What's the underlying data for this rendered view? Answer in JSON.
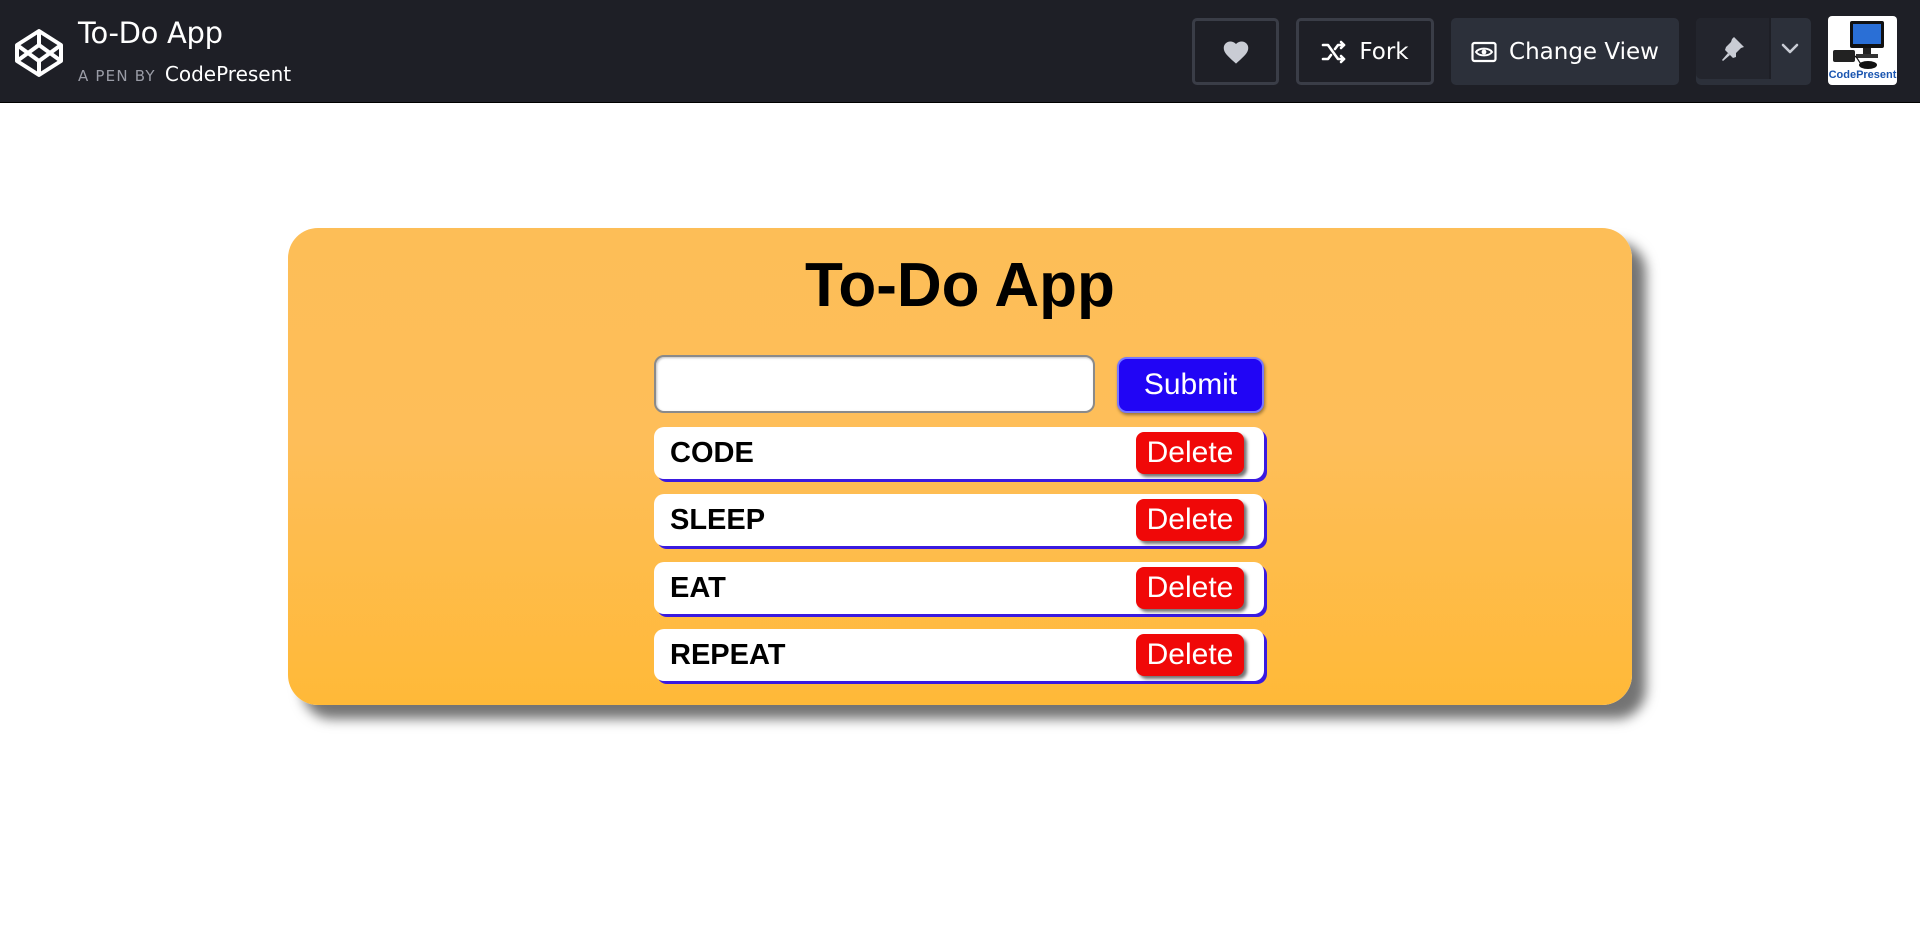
{
  "header": {
    "title": "To-Do App",
    "by_label": "A PEN BY",
    "author": "CodePresent",
    "fork_label": "Fork",
    "change_view_label": "Change View",
    "avatar_text": "CodePresent"
  },
  "app": {
    "title": "To-Do App",
    "input_value": "",
    "submit_label": "Submit",
    "delete_label": "Delete",
    "items": [
      {
        "text": "CODE"
      },
      {
        "text": "SLEEP"
      },
      {
        "text": "EAT"
      },
      {
        "text": "REPEAT"
      }
    ]
  },
  "colors": {
    "topbar_bg": "#1e1f26",
    "card_bg": "#fdbe57",
    "submit_bg": "#2105f5",
    "delete_bg": "#f00808",
    "item_shadow": "#3a1ae0"
  },
  "icons": [
    "codepen-logo-icon",
    "heart-icon",
    "fork-icon",
    "eye-icon",
    "pin-icon",
    "chevron-down-icon"
  ]
}
